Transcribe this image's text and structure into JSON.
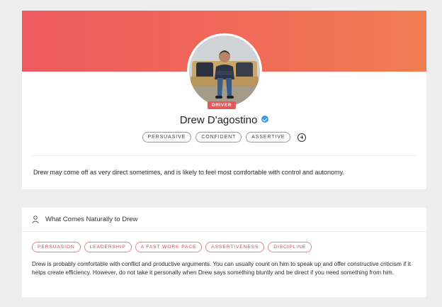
{
  "profile": {
    "name": "Drew D'agostino",
    "role_badge": "DRIVER",
    "traits": [
      "PERSUASIVE",
      "CONFIDENT",
      "ASSERTIVE"
    ],
    "summary": "Drew may come off as very direct sometimes, and is likely to feel most comfortable with control and autonomy."
  },
  "naturally": {
    "title": "What Comes Naturally to Drew",
    "strengths": [
      "PERSUASION",
      "LEADERSHIP",
      "A FAST WORK PACE",
      "ASSERTIVENESS",
      "DISCIPLINE"
    ],
    "description": "Drew is probably comfortable with conflict and productive arguments. You can usually count on him to speak up and offer constructive criticism if it helps create efficiency. However, do not take it personally when Drew says something bluntly and be direct if you need something from him."
  },
  "colors": {
    "banner_start": "#ee5a5f",
    "banner_end": "#f07d52",
    "accent": "#e4575c",
    "verified": "#3d9bd9"
  },
  "icons": {
    "verified": "verified-check-icon",
    "add_trait": "plus-circle-icon",
    "section": "person-icon"
  }
}
